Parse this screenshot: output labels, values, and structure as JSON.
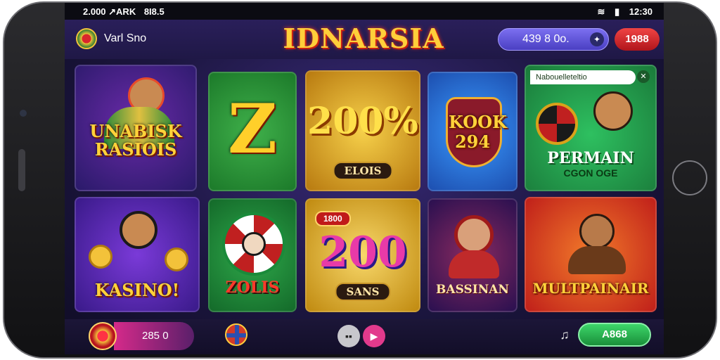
{
  "status_bar": {
    "left_text": "2.000 ↗ARK",
    "left_extra": "8I8.5",
    "right_icons": [
      "wifi-icon",
      "battery-icon"
    ],
    "time": "12:30"
  },
  "header": {
    "username": "Varl Sno",
    "logo": "IDNARSIA",
    "balance": "439 8 0o.",
    "deposit_label": "1988"
  },
  "tiles": [
    {
      "title": "UNABISK RASIOIS",
      "colors": [
        "#2a1a6a",
        "#6a2aa8"
      ]
    },
    {
      "title": "Z",
      "colors": [
        "#1c7a2a",
        "#3fb04a"
      ]
    },
    {
      "title": "200%",
      "subtitle": "ELOIS",
      "colors": [
        "#d9a21a",
        "#f6d04a"
      ]
    },
    {
      "title": "KOOK 294",
      "colors": [
        "#1d4fb0",
        "#3a9bff"
      ]
    },
    {
      "title": "PERMAIN",
      "subtitle": "CGON OGE",
      "header_text": "Nabouelleteltio",
      "colors": [
        "#1a7a3a",
        "#2ec060"
      ]
    },
    {
      "title": "KASINO!",
      "colors": [
        "#3a1a8a",
        "#7a3ad8"
      ]
    },
    {
      "title": "ZOLIS",
      "colors": [
        "#146a2a",
        "#2ea84a"
      ]
    },
    {
      "title": "200",
      "subtitle": "SANS",
      "badge": "1800",
      "colors": [
        "#e0a81a",
        "#f8d86a"
      ]
    },
    {
      "title": "BASSINAN",
      "colors": [
        "#2a1050",
        "#8a2a60"
      ]
    },
    {
      "title": "MULTPAINAIR",
      "colors": [
        "#d0301a",
        "#f27a2a"
      ]
    }
  ],
  "bottom_bar": {
    "points": "285 0",
    "claim_label": "A868"
  }
}
